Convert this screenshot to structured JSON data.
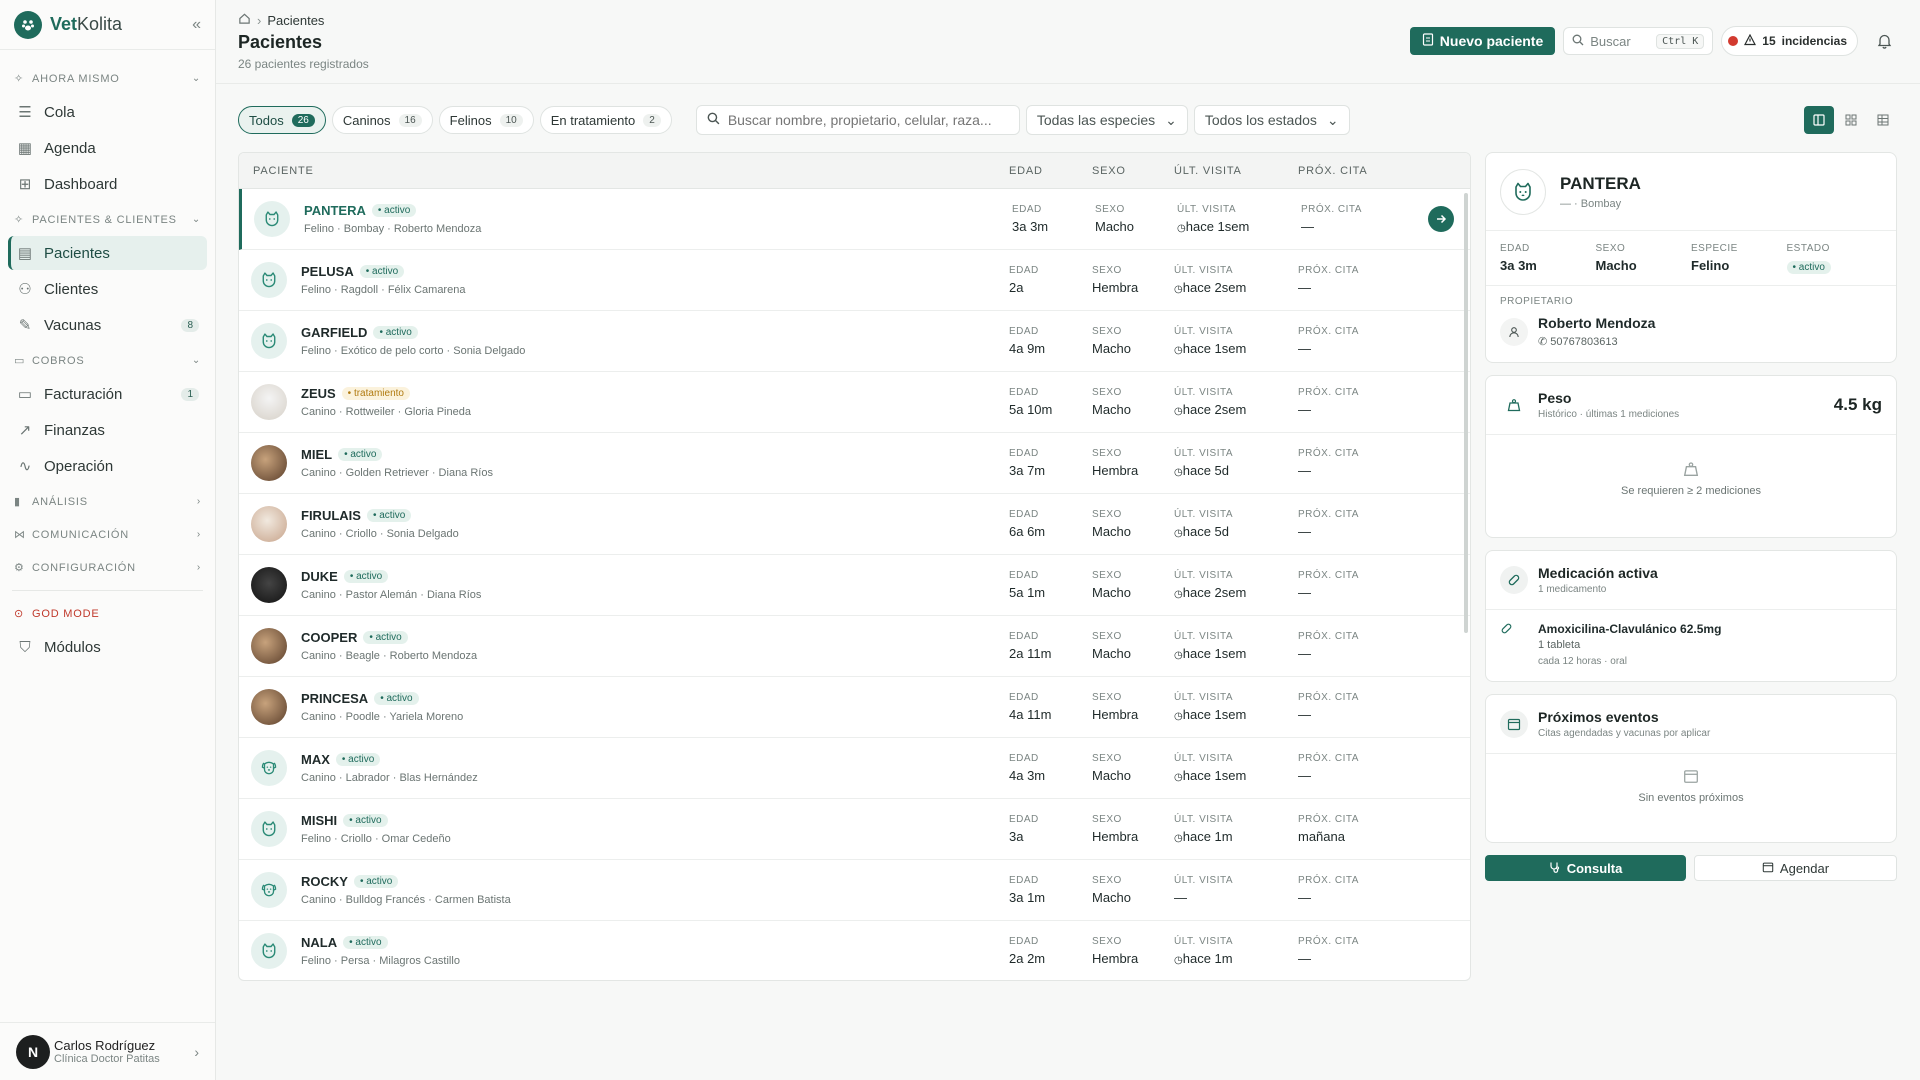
{
  "app": {
    "brand_bold": "Vet",
    "brand_light": "Kolita"
  },
  "sidebar": {
    "sections": {
      "now": "AHORA MISMO",
      "patients": "PACIENTES & CLIENTES",
      "billing": "COBROS",
      "analysis": "ANÁLISIS",
      "communication": "COMUNICACIÓN",
      "config": "CONFIGURACIÓN",
      "god": "GOD MODE"
    },
    "items": {
      "cola": "Cola",
      "agenda": "Agenda",
      "dashboard": "Dashboard",
      "pacientes": "Pacientes",
      "clientes": "Clientes",
      "vacunas": "Vacunas",
      "vacunas_badge": "8",
      "facturacion": "Facturación",
      "facturacion_badge": "1",
      "finanzas": "Finanzas",
      "operacion": "Operación",
      "modulos": "Módulos"
    },
    "user": {
      "initial": "N",
      "name": "Carlos Rodríguez",
      "org": "Clínica Doctor Patitas"
    }
  },
  "header": {
    "breadcrumb": "Pacientes",
    "title": "Pacientes",
    "subtitle": "26 pacientes registrados",
    "new_button": "Nuevo paciente",
    "search_label": "Buscar",
    "search_kbd": "Ctrl K",
    "incidents_count": "15",
    "incidents_label": "incidencias"
  },
  "filters": {
    "chips": [
      {
        "label": "Todos",
        "count": "26"
      },
      {
        "label": "Caninos",
        "count": "16"
      },
      {
        "label": "Felinos",
        "count": "10"
      },
      {
        "label": "En tratamiento",
        "count": "2"
      }
    ],
    "search_placeholder": "Buscar nombre, propietario, celular, raza...",
    "species_select": "Todas las especies",
    "status_select": "Todos los estados"
  },
  "table": {
    "columns": {
      "paciente": "PACIENTE",
      "edad": "EDAD",
      "sexo": "SEXO",
      "ult": "ÚLT. VISITA",
      "prox": "PRÓX. CITA"
    },
    "cell_labels": {
      "edad": "EDAD",
      "sexo": "SEXO",
      "ult": "ÚLT. VISITA",
      "prox": "PRÓX. CITA"
    },
    "rows": [
      {
        "name": "PANTERA",
        "status": "activo",
        "sub": "Felino · Bombay · Roberto Mendoza",
        "edad": "3a 3m",
        "sexo": "Macho",
        "ult": "hace 1sem",
        "prox": "—"
      },
      {
        "name": "PELUSA",
        "status": "activo",
        "sub": "Felino · Ragdoll · Félix Camarena",
        "edad": "2a",
        "sexo": "Hembra",
        "ult": "hace 2sem",
        "prox": "—"
      },
      {
        "name": "GARFIELD",
        "status": "activo",
        "sub": "Felino · Exótico de pelo corto · Sonia Delgado",
        "edad": "4a 9m",
        "sexo": "Macho",
        "ult": "hace 1sem",
        "prox": "—"
      },
      {
        "name": "ZEUS",
        "status": "tratamiento",
        "sub": "Canino · Rottweiler · Gloria Pineda",
        "edad": "5a 10m",
        "sexo": "Macho",
        "ult": "hace 2sem",
        "prox": "—"
      },
      {
        "name": "MIEL",
        "status": "activo",
        "sub": "Canino · Golden Retriever · Diana Ríos",
        "edad": "3a 7m",
        "sexo": "Hembra",
        "ult": "hace 5d",
        "prox": "—"
      },
      {
        "name": "FIRULAIS",
        "status": "activo",
        "sub": "Canino · Criollo · Sonia Delgado",
        "edad": "6a 6m",
        "sexo": "Macho",
        "ult": "hace 5d",
        "prox": "—"
      },
      {
        "name": "DUKE",
        "status": "activo",
        "sub": "Canino · Pastor Alemán · Diana Ríos",
        "edad": "5a 1m",
        "sexo": "Macho",
        "ult": "hace 2sem",
        "prox": "—"
      },
      {
        "name": "COOPER",
        "status": "activo",
        "sub": "Canino · Beagle · Roberto Mendoza",
        "edad": "2a 11m",
        "sexo": "Macho",
        "ult": "hace 1sem",
        "prox": "—"
      },
      {
        "name": "PRINCESA",
        "status": "activo",
        "sub": "Canino · Poodle · Yariela Moreno",
        "edad": "4a 11m",
        "sexo": "Hembra",
        "ult": "hace 1sem",
        "prox": "—"
      },
      {
        "name": "MAX",
        "status": "activo",
        "sub": "Canino · Labrador · Blas Hernández",
        "edad": "4a 3m",
        "sexo": "Macho",
        "ult": "hace 1sem",
        "prox": "—"
      },
      {
        "name": "MISHI",
        "status": "activo",
        "sub": "Felino · Criollo · Omar Cedeño",
        "edad": "3a",
        "sexo": "Hembra",
        "ult": "hace 1m",
        "prox": "mañana"
      },
      {
        "name": "ROCKY",
        "status": "activo",
        "sub": "Canino · Bulldog Francés · Carmen Batista",
        "edad": "3a 1m",
        "sexo": "Macho",
        "ult": "—",
        "prox": "—"
      },
      {
        "name": "NALA",
        "status": "activo",
        "sub": "Felino · Persa · Milagros Castillo",
        "edad": "2a 2m",
        "sexo": "Hembra",
        "ult": "hace 1m",
        "prox": "—"
      }
    ]
  },
  "detail": {
    "name": "PANTERA",
    "breed": "— · Bombay",
    "stats": [
      {
        "label": "EDAD",
        "value": "3a 3m"
      },
      {
        "label": "SEXO",
        "value": "Macho"
      },
      {
        "label": "ESPECIE",
        "value": "Felino"
      },
      {
        "label": "ESTADO",
        "value": "activo"
      }
    ],
    "owner_label": "PROPIETARIO",
    "owner_name": "Roberto Mendoza",
    "owner_phone": "50767803613",
    "weight": {
      "title": "Peso",
      "sub": "Histórico · últimas 1 mediciones",
      "value": "4.5 kg",
      "empty": "Se requieren ≥ 2 mediciones"
    },
    "medication": {
      "title": "Medicación activa",
      "sub": "1 medicamento",
      "name": "Amoxicilina-Clavulánico 62.5mg",
      "dose": "1 tableta",
      "freq": "cada 12 horas · oral"
    },
    "events": {
      "title": "Próximos eventos",
      "sub": "Citas agendadas y vacunas por aplicar",
      "empty": "Sin eventos próximos"
    },
    "btn_consulta": "Consulta",
    "btn_agendar": "Agendar"
  },
  "colors": {
    "brand": "#1f6b5c",
    "alert": "#d23a2f",
    "treatment": "#b07a10"
  }
}
